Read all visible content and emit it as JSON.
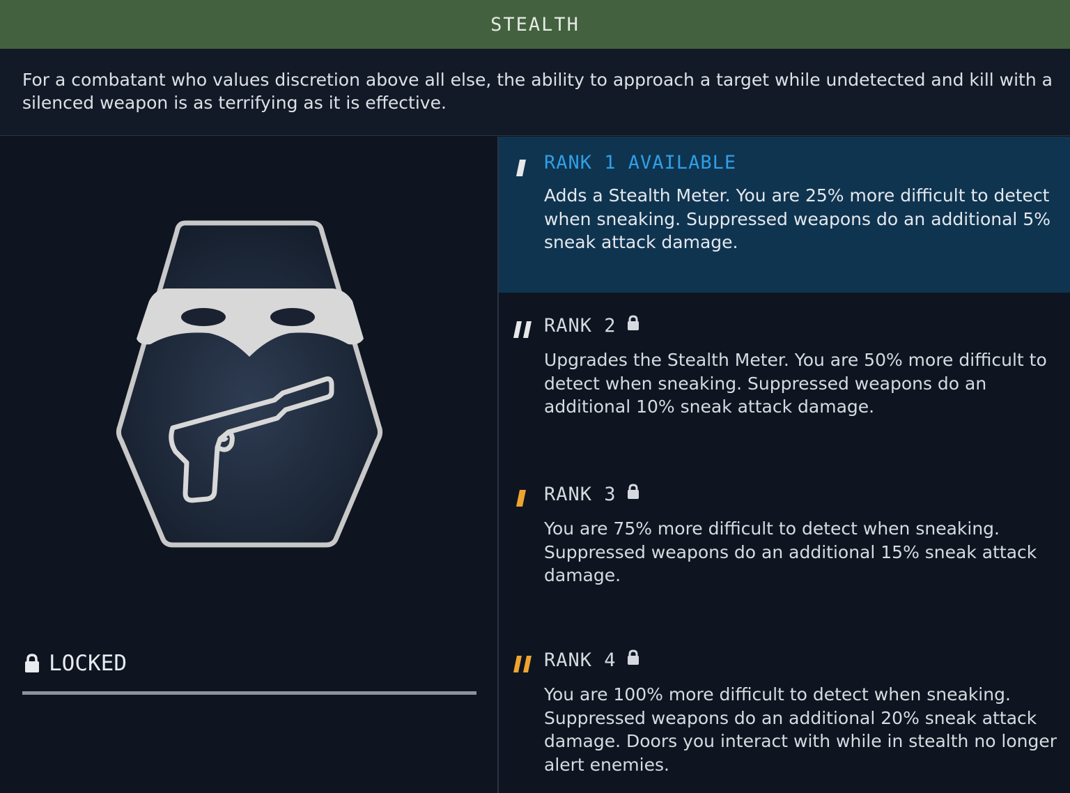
{
  "header": {
    "title": "STEALTH"
  },
  "description": "For a combatant who values discretion above all else, the ability to approach a target while undetected and kill with a silenced weapon is as terrifying as it is effective.",
  "skill": {
    "badge_icon": "masked-figure-with-silenced-pistol-icon",
    "status_label": "LOCKED",
    "status_icon": "lock-icon",
    "progress": 0
  },
  "ranks": [
    {
      "label": "RANK 1 AVAILABLE",
      "locked": false,
      "tick_icon": "rank-tick-1-icon",
      "description": "Adds a Stealth Meter. You are 25% more difficult to detect when sneaking. Suppressed weapons do an additional 5% sneak attack damage."
    },
    {
      "label": "RANK 2",
      "locked": true,
      "tick_icon": "rank-tick-2-icon",
      "description": "Upgrades the Stealth Meter. You are 50% more difficult to detect when sneaking. Suppressed weapons do an additional 10% sneak attack damage."
    },
    {
      "label": "RANK 3",
      "locked": true,
      "tick_icon": "rank-tick-3-icon",
      "description": "You are 75% more difficult to detect when sneaking. Suppressed weapons do an additional 15% sneak attack damage."
    },
    {
      "label": "RANK 4",
      "locked": true,
      "tick_icon": "rank-tick-4-icon",
      "description": "You are 100% more difficult to detect when sneaking. Suppressed weapons do an additional 20% sneak attack damage. Doors you interact with while in stealth no longer alert enemies."
    }
  ],
  "colors": {
    "header_bg": "#43613e",
    "background": "#0e1520",
    "active_rank_bg": "#0f3450",
    "active_rank_text": "#2f9fe6",
    "tick_gold": "#f0a430",
    "tick_white": "#e6e8ea"
  }
}
